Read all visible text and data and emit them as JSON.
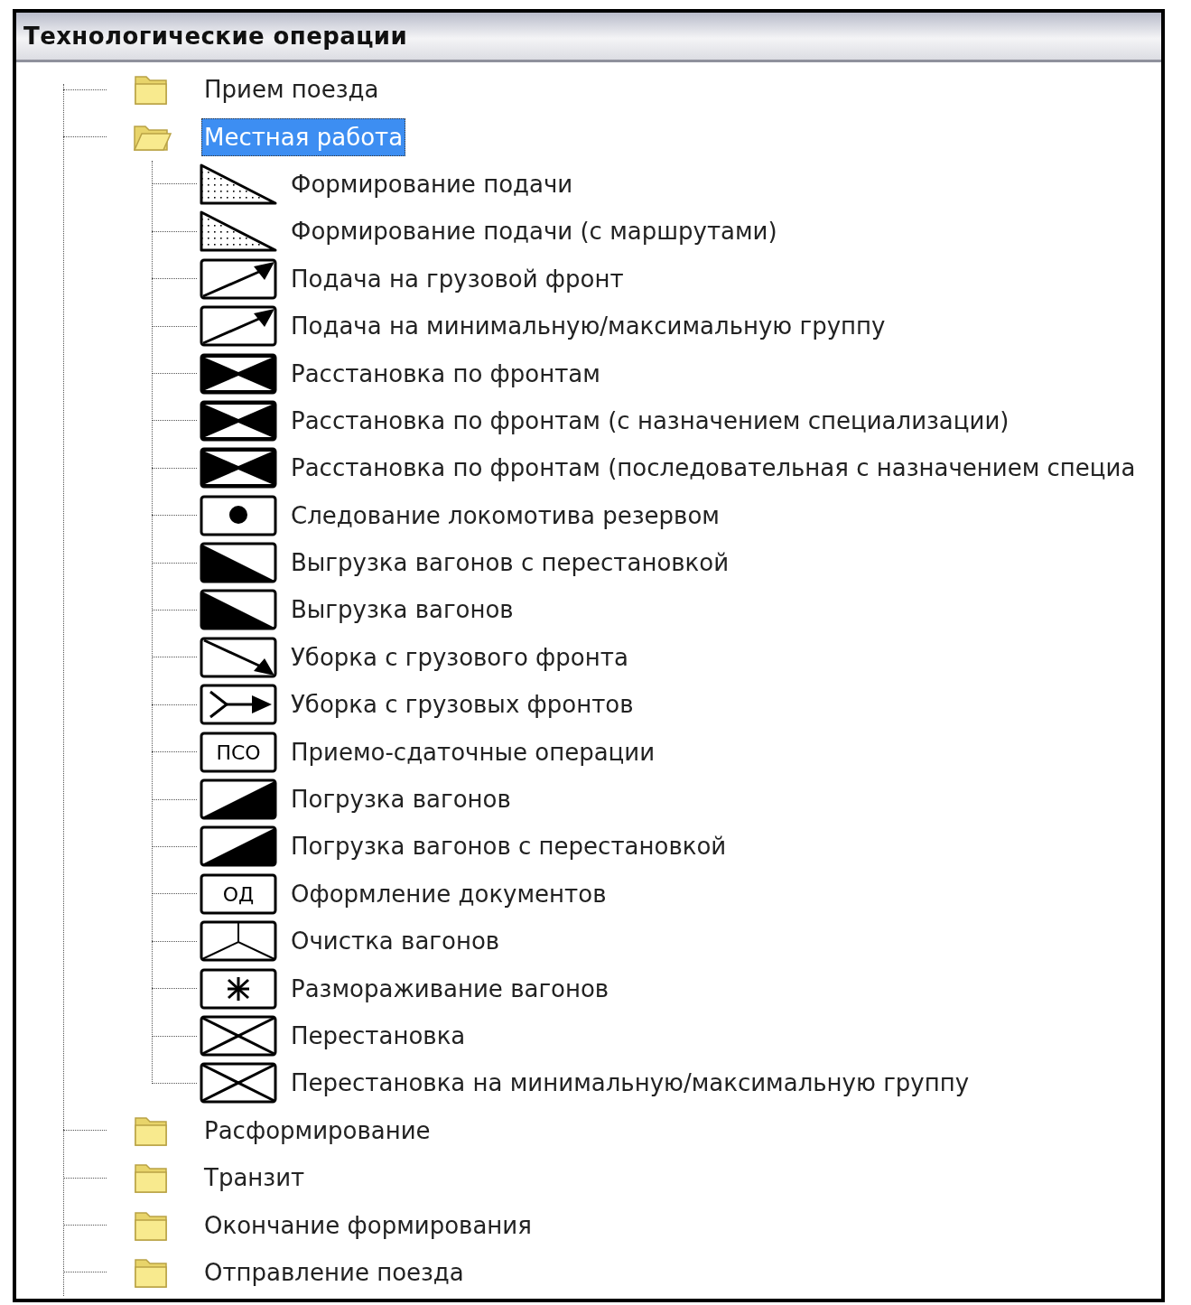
{
  "window": {
    "title": "Технологические операции"
  },
  "tree": {
    "items": [
      {
        "label": "Прием поезда",
        "selected": false,
        "expanded": false
      },
      {
        "label": "Местная работа",
        "selected": true,
        "expanded": true,
        "children": [
          {
            "label": "Формирование подачи",
            "kind": "dotted-triangle",
            "selected": false
          },
          {
            "label": "Формирование подачи (с маршрутами)",
            "kind": "dotted-triangle",
            "selected": false
          },
          {
            "label": "Подача на грузовой фронт",
            "kind": "arrow-up-right",
            "selected": false
          },
          {
            "label": "Подача на минимальную/максимальную группу",
            "kind": "arrow-up-right",
            "selected": false
          },
          {
            "label": "Расстановка по фронтам",
            "kind": "bowtie",
            "selected": false
          },
          {
            "label": "Расстановка по фронтам (с назначением специализации)",
            "kind": "bowtie",
            "selected": false
          },
          {
            "label": "Расстановка по фронтам (последовательная с назначением специа",
            "kind": "bowtie",
            "selected": false
          },
          {
            "label": "Следование локомотива резервом",
            "kind": "dot",
            "selected": false
          },
          {
            "label": "Выгрузка вагонов с перестановкой",
            "kind": "unload",
            "selected": false
          },
          {
            "label": "Выгрузка вагонов",
            "kind": "unload",
            "selected": false
          },
          {
            "label": "Уборка с грузового фронта",
            "kind": "arrow-down-right",
            "selected": false
          },
          {
            "label": "Уборка с грузовых фронтов",
            "kind": "fork-arrow",
            "selected": false
          },
          {
            "label": "Приемо-сдаточные операции",
            "kind": "label",
            "icon_text": "ПСО",
            "selected": false
          },
          {
            "label": "Погрузка вагонов",
            "kind": "load",
            "selected": false
          },
          {
            "label": "Погрузка вагонов с перестановкой",
            "kind": "load",
            "selected": false
          },
          {
            "label": "Оформление документов",
            "kind": "label",
            "icon_text": "ОД",
            "selected": false
          },
          {
            "label": "Очистка вагонов",
            "kind": "y-lines",
            "selected": false
          },
          {
            "label": "Размораживание вагонов",
            "kind": "asterisk",
            "selected": false
          },
          {
            "label": "Перестановка",
            "kind": "cross",
            "selected": false
          },
          {
            "label": "Перестановка на минимальную/максимальную группу",
            "kind": "cross",
            "selected": false
          }
        ]
      },
      {
        "label": "Расформирование",
        "selected": false,
        "expanded": false
      },
      {
        "label": "Транзит",
        "selected": false,
        "expanded": false
      },
      {
        "label": "Окончание формирования",
        "selected": false,
        "expanded": false
      },
      {
        "label": "Отправление поезда",
        "selected": false,
        "expanded": false
      }
    ]
  }
}
